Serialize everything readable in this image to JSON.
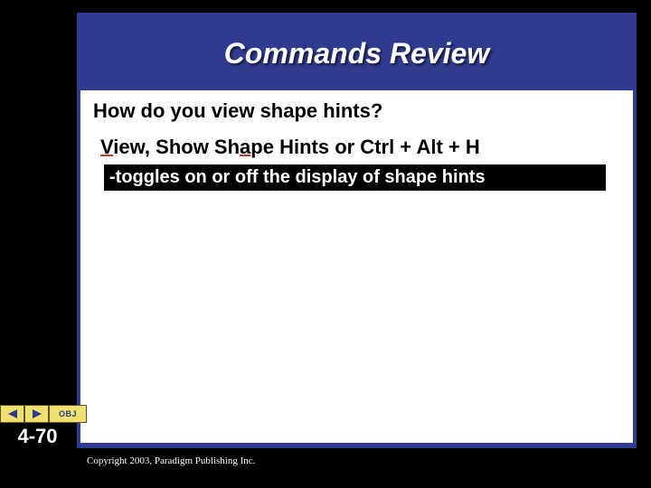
{
  "title": "Commands Review",
  "question": "How do you view shape hints?",
  "answer": {
    "seg1_underlined": "V",
    "seg2": "iew, Show Sh",
    "seg3_underlined": "a",
    "seg4": "pe Hints or Ctrl + Alt + H"
  },
  "toggle_text": "-toggles on or off the display of shape hints",
  "nav": {
    "obj_label": "OBJ"
  },
  "slide_number": "4-70",
  "copyright": "Copyright 2003, Paradigm Publishing Inc."
}
